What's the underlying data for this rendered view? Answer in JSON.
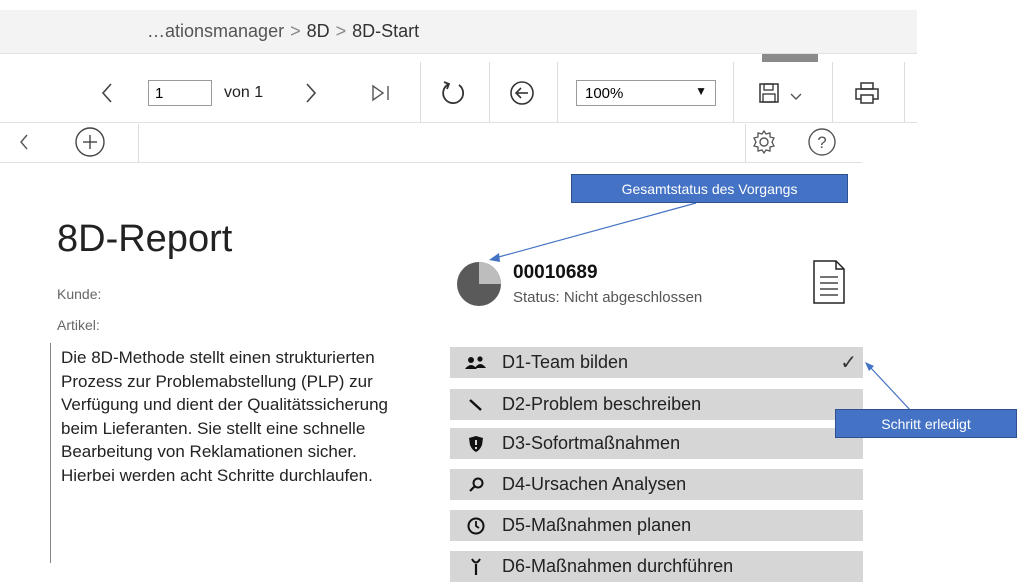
{
  "breadcrumb": {
    "item1": "…ationsmanager",
    "item2": "8D",
    "item3": "8D-Start",
    "separator": ">"
  },
  "toolbar": {
    "page_value": "1",
    "page_of": "von 1",
    "zoom_value": "100%",
    "icons": [
      "previous-page-icon",
      "next-page-icon",
      "last-page-icon",
      "refresh-icon",
      "back-icon",
      "save-icon",
      "print-icon"
    ]
  },
  "row2": {
    "icons": [
      "collapse-icon",
      "add-icon",
      "settings-icon",
      "help-icon"
    ]
  },
  "report": {
    "title": "8D-Report",
    "kunde_label": "Kunde:",
    "artikel_label": "Artikel:",
    "description": "Die 8D-Methode stellt einen strukturierten Prozess zur Problemabstellung (PLP) zur Verfügung und dient der Qualitätssicherung beim Lieferanten. Sie stellt eine schnelle Bearbeitung von Reklamationen sicher. Hierbei werden acht Schritte durchlaufen."
  },
  "status": {
    "number": "00010689",
    "text": "Status: Nicht abgeschlossen",
    "progress_fraction": 0.25
  },
  "steps": [
    {
      "label": "D1-Team bilden",
      "icon": "team-icon",
      "done": true,
      "check": "✓"
    },
    {
      "label": "D2-Problem beschreiben",
      "icon": "pen-icon",
      "done": false
    },
    {
      "label": "D3-Sofortmaßnahmen",
      "icon": "shield-icon",
      "done": false
    },
    {
      "label": "D4-Ursachen Analysen",
      "icon": "search-icon",
      "done": false
    },
    {
      "label": "D5-Maßnahmen planen",
      "icon": "clock-icon",
      "done": false
    },
    {
      "label": "D6-Maßnahmen durchführen",
      "icon": "tool-icon",
      "done": false
    }
  ],
  "callouts": {
    "gesamtstatus": "Gesamtstatus des Vorgangs",
    "schritt": "Schritt erledigt"
  },
  "colors": {
    "accent": "#4472c4",
    "step_bg": "#d6d6d6"
  }
}
